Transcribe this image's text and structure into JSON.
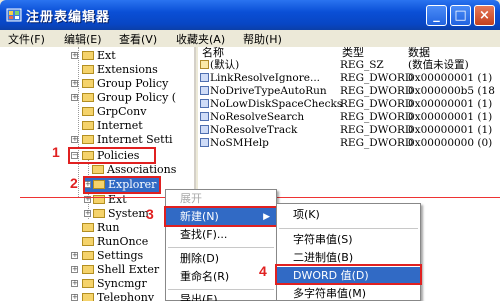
{
  "window": {
    "title": "注册表编辑器",
    "min_glyph": "_",
    "max_glyph": "□",
    "close_glyph": "×"
  },
  "menubar": [
    "文件(F)",
    "编辑(E)",
    "查看(V)",
    "收藏夹(A)",
    "帮助(H)"
  ],
  "tree": {
    "items": [
      {
        "label": "Ext"
      },
      {
        "label": "Extensions"
      },
      {
        "label": "Group Policy"
      },
      {
        "label": "Group Policy ("
      },
      {
        "label": "GrpConv"
      },
      {
        "label": "Internet"
      },
      {
        "label": "Internet Setti"
      },
      {
        "label": "Policies"
      },
      {
        "label": "Associations"
      },
      {
        "label": "Explorer"
      },
      {
        "label": "Ext"
      },
      {
        "label": "System"
      },
      {
        "label": "Run"
      },
      {
        "label": "RunOnce"
      },
      {
        "label": "Settings"
      },
      {
        "label": "Shell Exter"
      },
      {
        "label": "Syncmgr"
      },
      {
        "label": "Telephony"
      }
    ]
  },
  "list": {
    "headers": {
      "name": "名称",
      "type": "类型",
      "data": "数据"
    },
    "rows": [
      {
        "name": "(默认)",
        "type": "REG_SZ",
        "data": "(数值未设置)"
      },
      {
        "name": "LinkResolveIgnore...",
        "type": "REG_DWORD",
        "data": "0x00000001 (1)"
      },
      {
        "name": "NoDriveTypeAutoRun",
        "type": "REG_DWORD",
        "data": "0x000000b5 (18"
      },
      {
        "name": "NoLowDiskSpaceChecks",
        "type": "REG_DWORD",
        "data": "0x00000001 (1)"
      },
      {
        "name": "NoResolveSearch",
        "type": "REG_DWORD",
        "data": "0x00000001 (1)"
      },
      {
        "name": "NoResolveTrack",
        "type": "REG_DWORD",
        "data": "0x00000001 (1)"
      },
      {
        "name": "NoSMHelp",
        "type": "REG_DWORD",
        "data": "0x00000000 (0)"
      }
    ]
  },
  "context_menu": {
    "items": [
      {
        "label": "展开"
      },
      {
        "label": "新建(N)"
      },
      {
        "label": "查找(F)..."
      },
      {
        "label": "删除(D)"
      },
      {
        "label": "重命名(R)"
      },
      {
        "label": "导出(E)"
      }
    ]
  },
  "submenu": {
    "items": [
      {
        "label": "项(K)"
      },
      {
        "label": "字符串值(S)"
      },
      {
        "label": "二进制值(B)"
      },
      {
        "label": "DWORD 值(D)"
      },
      {
        "label": "多字符串值(M)"
      }
    ]
  },
  "annotations": [
    "1",
    "2",
    "3",
    "4"
  ],
  "colors": {
    "annotation": "#e02020",
    "highlight": "#316ac5",
    "titlebar": "#0a4fd6"
  }
}
